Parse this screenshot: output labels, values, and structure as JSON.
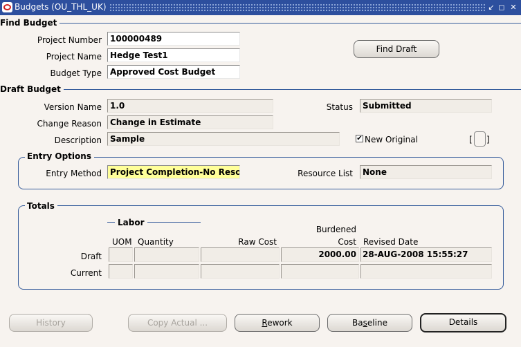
{
  "window": {
    "title": "Budgets (OU_THL_UK)"
  },
  "find_budget": {
    "section_title": "Find Budget",
    "project_number_label": "Project Number",
    "project_number": "100000489",
    "project_name_label": "Project Name",
    "project_name": "Hedge Test1",
    "budget_type_label": "Budget Type",
    "budget_type": "Approved Cost Budget",
    "find_draft_button": "Find Draft"
  },
  "draft_budget": {
    "section_title": "Draft Budget",
    "version_name_label": "Version Name",
    "version_name": "1.0",
    "status_label": "Status",
    "status": "Submitted",
    "change_reason_label": "Change Reason",
    "change_reason": "Change in Estimate",
    "description_label": "Description",
    "description": "Sample",
    "new_original_label": "New Original",
    "new_original_checked": true,
    "new_original_mark": "✔",
    "flex_open": "[",
    "flex_close": "]"
  },
  "entry_options": {
    "section_title": "Entry Options",
    "entry_method_label": "Entry Method",
    "entry_method": "Project Completion-No Resou",
    "resource_list_label": "Resource List",
    "resource_list": "None"
  },
  "totals": {
    "section_title": "Totals",
    "labor_title": "Labor",
    "col_uom": "UOM",
    "col_quantity": "Quantity",
    "col_raw_cost": "Raw Cost",
    "col_burdened_line1": "Burdened",
    "col_burdened_line2": "Cost",
    "col_revised_date": "Revised Date",
    "row_draft_label": "Draft",
    "row_current_label": "Current",
    "draft": {
      "uom": "",
      "quantity": "",
      "raw_cost": "",
      "burdened_cost": "2000.00",
      "revised_date": "28-AUG-2008 15:55:27"
    },
    "current": {
      "uom": "",
      "quantity": "",
      "raw_cost": "",
      "burdened_cost": "",
      "revised_date": ""
    }
  },
  "buttons": {
    "history": "History",
    "copy_actual": "Copy Actual ...",
    "rework_key": "R",
    "rework_rest": "ework",
    "baseline_pre": "Ba",
    "baseline_key": "s",
    "baseline_rest": "eline",
    "details": "Details"
  }
}
